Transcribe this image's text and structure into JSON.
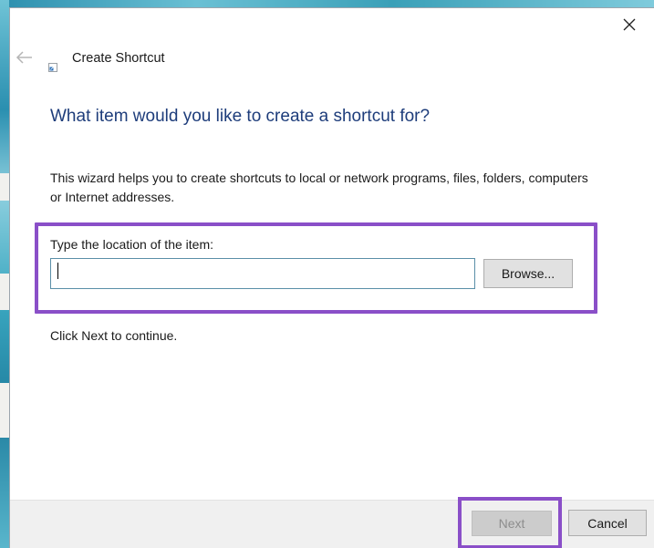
{
  "window": {
    "title": "Create Shortcut",
    "close_icon": "close-icon",
    "back_icon": "back-arrow-icon",
    "app_icon": "shortcut-icon"
  },
  "content": {
    "heading": "What item would you like to create a shortcut for?",
    "description": "This wizard helps you to create shortcuts to local or network programs, files, folders, computers or Internet addresses.",
    "location_label": "Type the location of the item:",
    "location_value": "",
    "browse_label": "Browse...",
    "continue_text": "Click Next to continue."
  },
  "footer": {
    "next_label": "Next",
    "cancel_label": "Cancel"
  },
  "colors": {
    "heading": "#1e3d7b",
    "highlight": "#8a4fc8",
    "footer_bg": "#f0f0f0"
  }
}
